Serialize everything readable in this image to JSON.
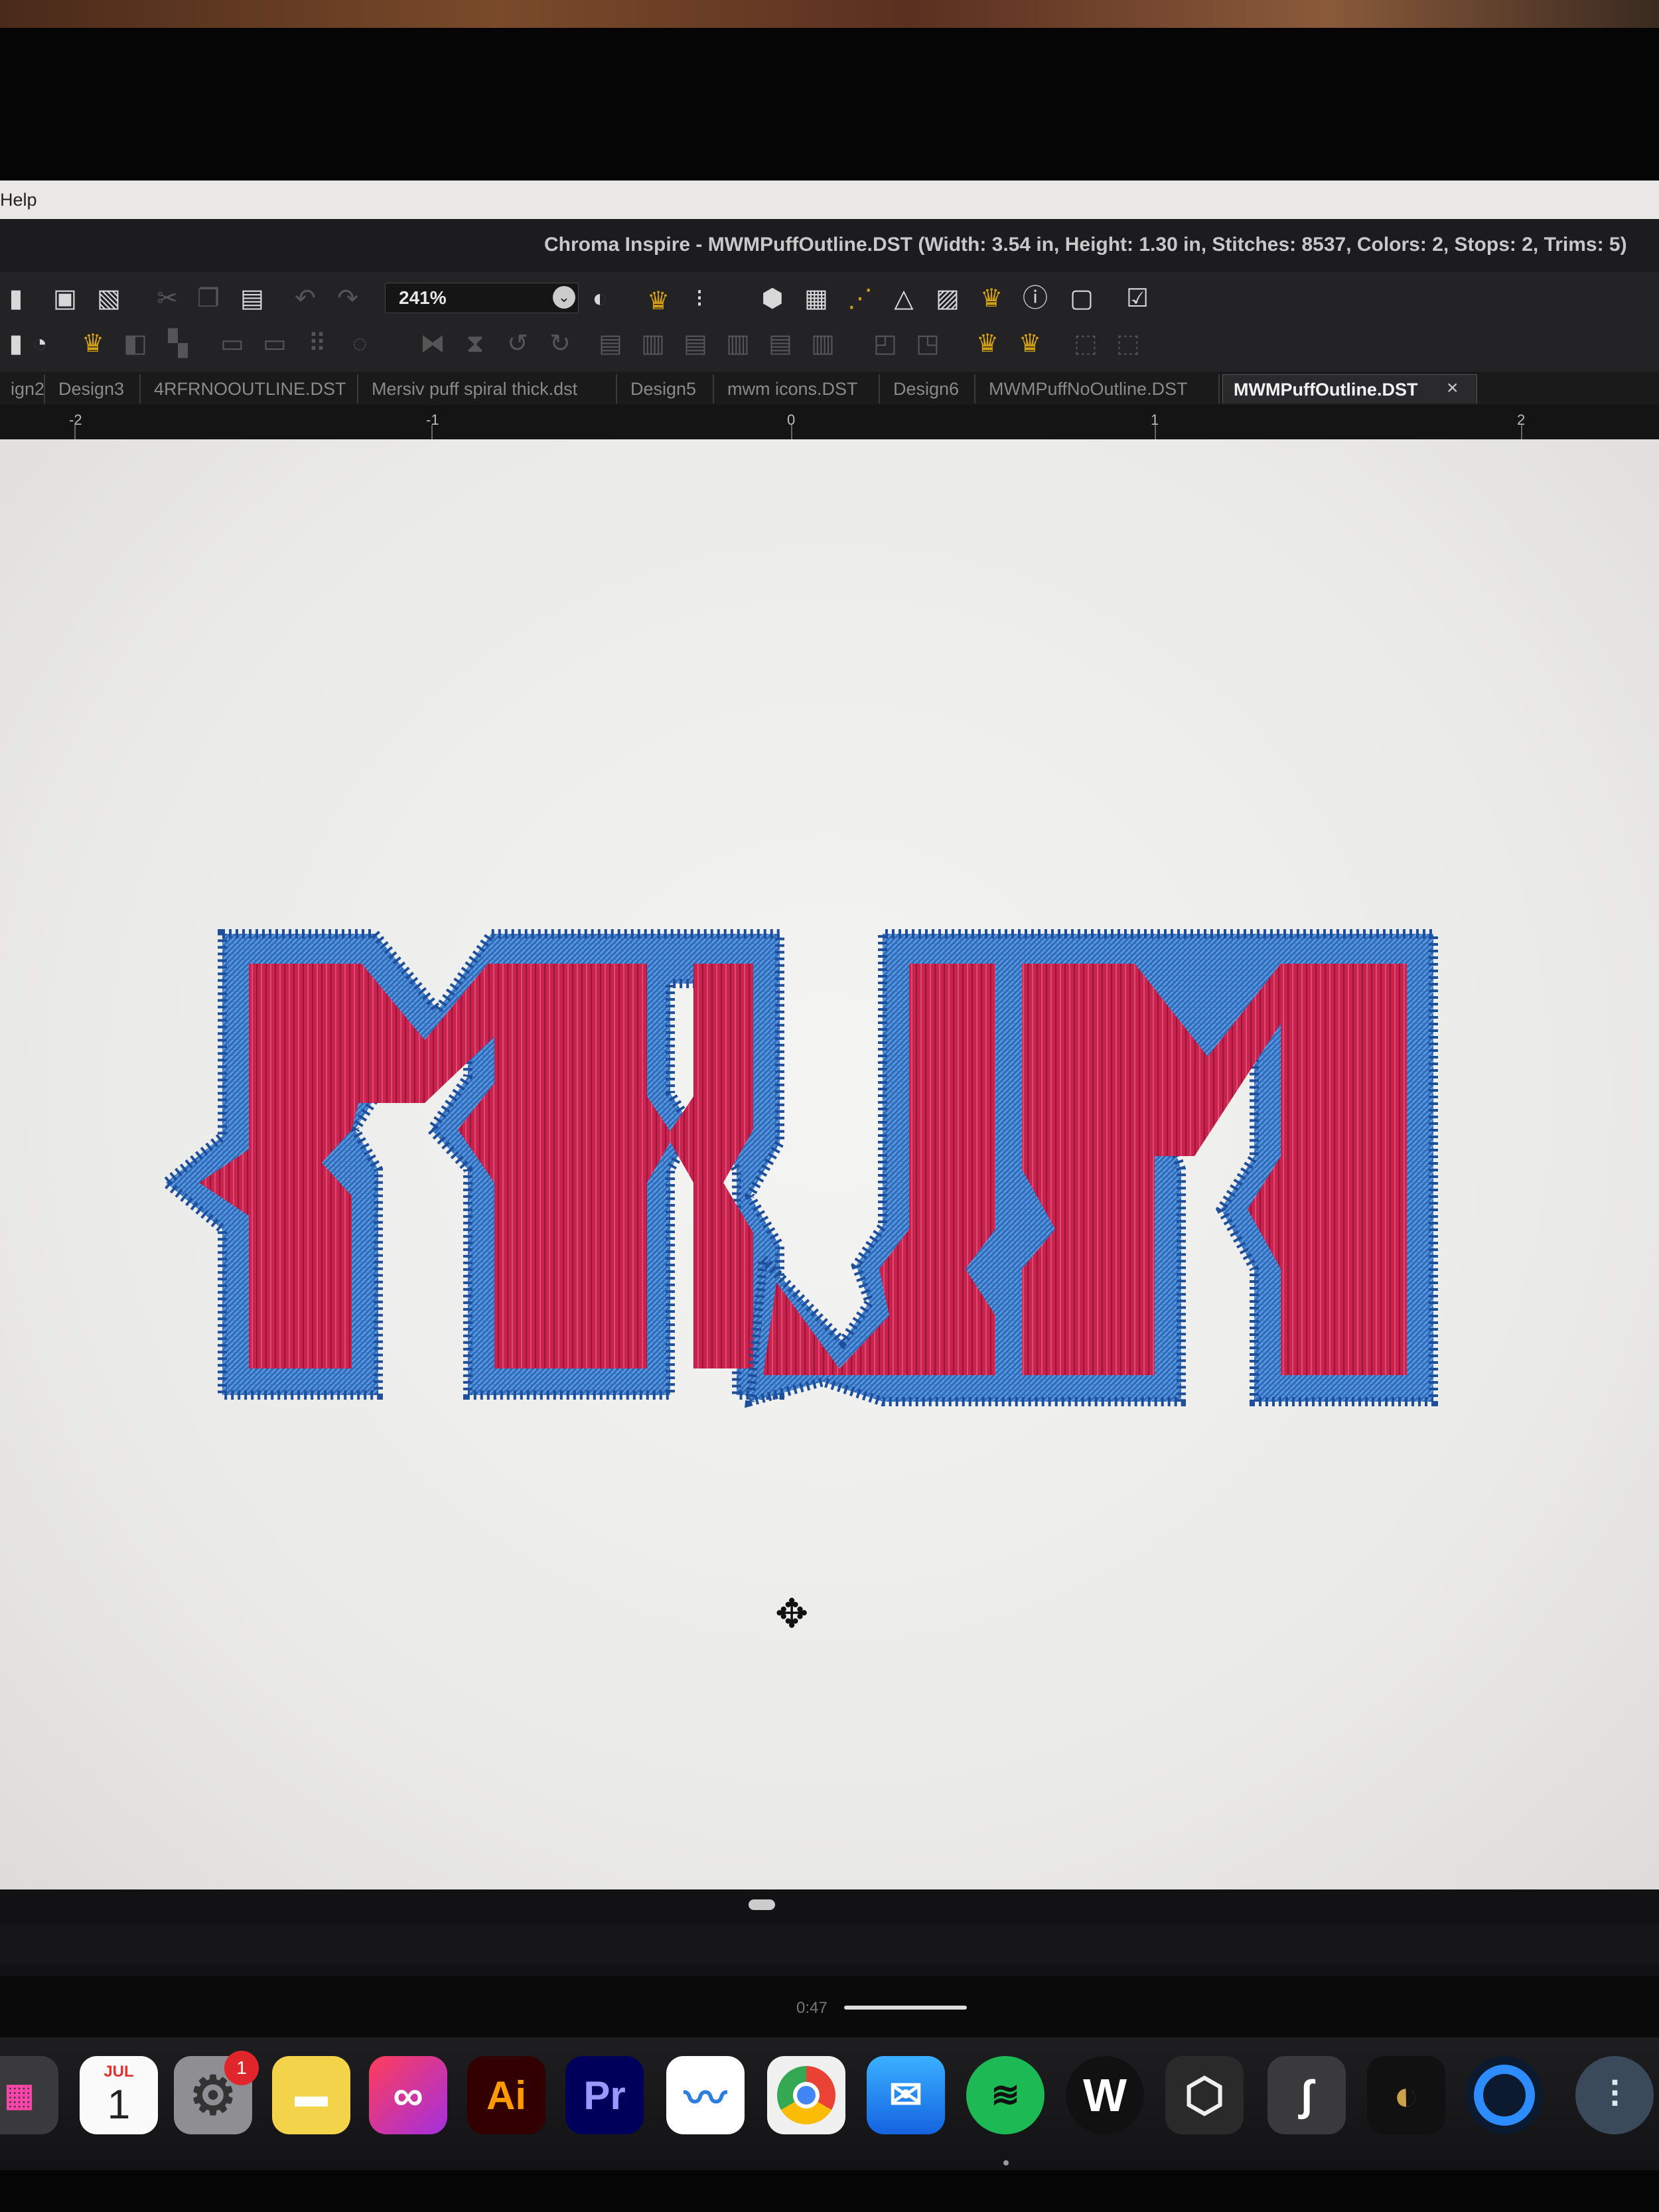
{
  "menu": {
    "help": "Help"
  },
  "window": {
    "title": "Chroma Inspire - MWMPuffOutline.DST (Width: 3.54 in, Height: 1.30 in, Stitches: 8537, Colors: 2, Stops: 2, Trims: 5)"
  },
  "toolbar": {
    "zoom_value": "241%"
  },
  "tabs": [
    {
      "label": "ign2"
    },
    {
      "label": "Design3"
    },
    {
      "label": "4RFRNOOUTLINE.DST"
    },
    {
      "label": "Mersiv puff spiral thick.dst"
    },
    {
      "label": "Design5"
    },
    {
      "label": "mwm icons.DST"
    },
    {
      "label": "Design6"
    },
    {
      "label": "MWMPuffNoOutline.DST"
    },
    {
      "label": "MWMPuffOutline.DST"
    }
  ],
  "tab_close": "×",
  "ruler": {
    "labels": [
      "-2",
      "-1",
      "0",
      "1",
      "2"
    ]
  },
  "player": {
    "time": "0:47"
  },
  "dock": {
    "calendar_month": "JUL",
    "calendar_day": "1",
    "settings_badge": "1",
    "illustrator_label": "Ai",
    "premiere_label": "Pr"
  },
  "colors": {
    "fill": "#c8234e",
    "outline": "#2f6fc0",
    "canvas": "#f0f0ee"
  }
}
